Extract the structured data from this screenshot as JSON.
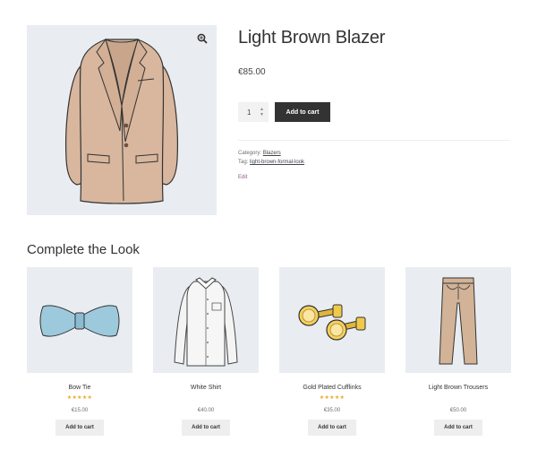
{
  "product": {
    "title": "Light Brown Blazer",
    "price": "€85.00",
    "quantity": "1",
    "add_to_cart_label": "Add to cart",
    "category_label": "Category:",
    "category": "Blazers",
    "tag_label": "Tag:",
    "tag": "light-brown-formal-look",
    "edit_label": "Edit",
    "zoom_icon": "zoom-in-icon"
  },
  "related": {
    "title": "Complete the Look",
    "items": [
      {
        "name": "Bow Tie",
        "rating_stars": "★★★★★",
        "rating": 5,
        "price": "€15.00",
        "button": "Add to cart"
      },
      {
        "name": "White Shirt",
        "rating_stars": "",
        "rating": null,
        "price": "€40.00",
        "button": "Add to cart"
      },
      {
        "name": "Gold Plated Cufflinks",
        "rating_stars": "★★★★★",
        "rating": 5,
        "price": "€35.00",
        "button": "Add to cart"
      },
      {
        "name": "Light Brown Trousers",
        "rating_stars": "",
        "rating": null,
        "price": "€50.00",
        "button": "Add to cart"
      }
    ]
  },
  "colors": {
    "button_dark": "#333333",
    "image_bg": "#e9edf2",
    "star": "#eeaa22",
    "edit_link": "#96588a"
  }
}
